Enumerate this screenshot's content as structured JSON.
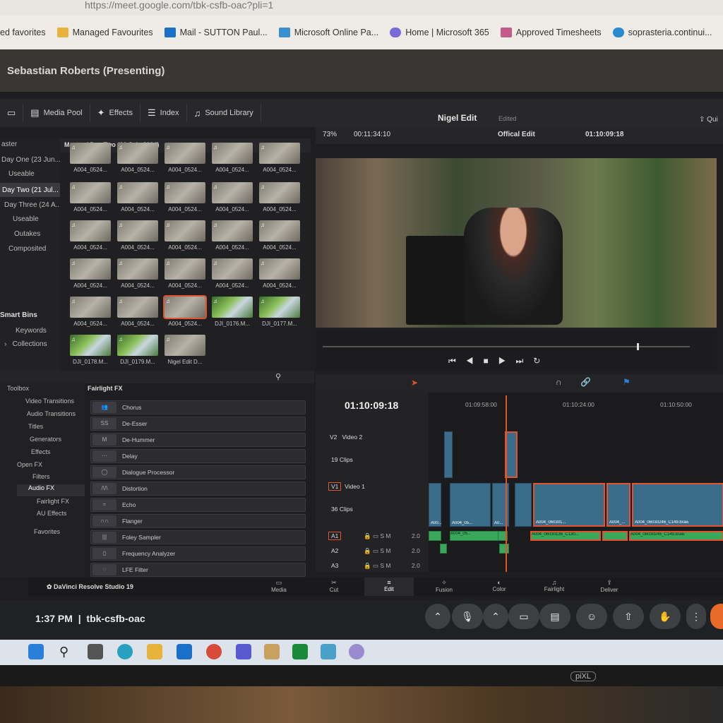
{
  "browser": {
    "url": "https://meet.google.com/tbk-csfb-oac?pli=1",
    "bookmarks": [
      {
        "label": "ed favorites",
        "icon": "none"
      },
      {
        "label": "Managed Favourites",
        "icon": "folder-icon"
      },
      {
        "label": "Mail - SUTTON Paul...",
        "icon": "outlook-icon"
      },
      {
        "label": "Microsoft Online Pa...",
        "icon": "microsoft-icon"
      },
      {
        "label": "Home | Microsoft 365",
        "icon": "m365-icon"
      },
      {
        "label": "Approved Timesheets",
        "icon": "timesheet-icon"
      },
      {
        "label": "soprasteria.continui...",
        "icon": "web-icon"
      }
    ]
  },
  "meet": {
    "presenter": "Sebastian Roberts (Presenting)",
    "time": "1:37 PM",
    "separator": "|",
    "meeting_code": "tbk-csfb-oac"
  },
  "resolve": {
    "toolbar": {
      "media_pool": "Media Pool",
      "effects": "Effects",
      "index": "Index",
      "sound_library": "Sound Library"
    },
    "project_title": "Nigel Edit",
    "project_status": "Edited",
    "quick_export": "Qui",
    "viewer": {
      "zoom": "73%",
      "duration": "00:11:34:10",
      "timeline_name": "Offical Edit",
      "timecode": "01:10:09:18"
    },
    "bins": {
      "master": "aster",
      "items": [
        "Day One (23 Jun...",
        "Useable",
        "Day Two (21 Jul...",
        "Day Three (24 A...",
        "Useable",
        "Outakes",
        "Composited"
      ],
      "smart_bins": "Smart Bins",
      "smart_items": [
        "Keywords",
        "Collections"
      ]
    },
    "pool_path": "Master / Day Two (21 July 2024)",
    "clips": [
      "A004_0524...",
      "A004_0524...",
      "A004_0524...",
      "A004_0524...",
      "A004_0524...",
      "A004_0524...",
      "A004_0524...",
      "A004_0524...",
      "A004_0524...",
      "A004_0524...",
      "A004_0524...",
      "A004_0524...",
      "A004_0524...",
      "A004_0524...",
      "A004_0524...",
      "A004_0524...",
      "A004_0524...",
      "A004_0524...",
      "A004_0524...",
      "A004_0524...",
      "A004_0524...",
      "A004_0524...",
      "A004_0524...",
      "DJI_0176.M...",
      "DJI_0177.M...",
      "DJI_0178.M...",
      "DJI_0179.M...",
      "Nigel Edit D..."
    ],
    "toolbox": {
      "items": [
        "Toolbox",
        "Video Transitions",
        "Audio Transitions",
        "Titles",
        "Generators",
        "Effects",
        "Open FX",
        "Filters",
        "Audio FX",
        "Fairlight FX",
        "AU Effects",
        "Favorites"
      ]
    },
    "fx_heading": "Fairlight FX",
    "fx_items": [
      {
        "label": "Chorus",
        "icon": "chorus-icon",
        "glyph": "👥"
      },
      {
        "label": "De-Esser",
        "icon": "de-esser-icon",
        "glyph": "SS"
      },
      {
        "label": "De-Hummer",
        "icon": "de-hummer-icon",
        "glyph": "M"
      },
      {
        "label": "Delay",
        "icon": "delay-icon",
        "glyph": "⋯"
      },
      {
        "label": "Dialogue Processor",
        "icon": "dialogue-icon",
        "glyph": "◯"
      },
      {
        "label": "Distortion",
        "icon": "distortion-icon",
        "glyph": "/\\/\\"
      },
      {
        "label": "Echo",
        "icon": "echo-icon",
        "glyph": "≈"
      },
      {
        "label": "Flanger",
        "icon": "flanger-icon",
        "glyph": "∩∩"
      },
      {
        "label": "Foley Sampler",
        "icon": "foley-icon",
        "glyph": "|||"
      },
      {
        "label": "Frequency Analyzer",
        "icon": "analyzer-icon",
        "glyph": "▯"
      },
      {
        "label": "LFE Filter",
        "icon": "lfe-icon",
        "glyph": "◌"
      }
    ],
    "timeline": {
      "timecode": "01:10:09:18",
      "ruler": [
        "01:09:58:00",
        "01:10:24:00",
        "01:10:50:00"
      ],
      "tracks": [
        {
          "id": "V2",
          "name": "Video 2",
          "clips": "19 Clips"
        },
        {
          "id": "V1",
          "name": "Video 1",
          "clips": "36 Clips"
        },
        {
          "id": "A1",
          "level": "2.0"
        },
        {
          "id": "A2",
          "level": "2.0"
        },
        {
          "id": "A3",
          "level": "2.0"
        }
      ],
      "clip_labels": [
        "A00...",
        "A004_05...",
        "A0...",
        "A004_060301...",
        "A004_...",
        "A004_06030246_C149.braw",
        "A004_06030136_C130...",
        "A004_06030246_C149.braw"
      ]
    },
    "pages": [
      "Media",
      "Cut",
      "Edit",
      "Fusion",
      "Color",
      "Fairlight",
      "Deliver"
    ],
    "active_page": "Edit",
    "app_name": "DaVinci Resolve Studio 19"
  },
  "monitor_brand": "piXL"
}
